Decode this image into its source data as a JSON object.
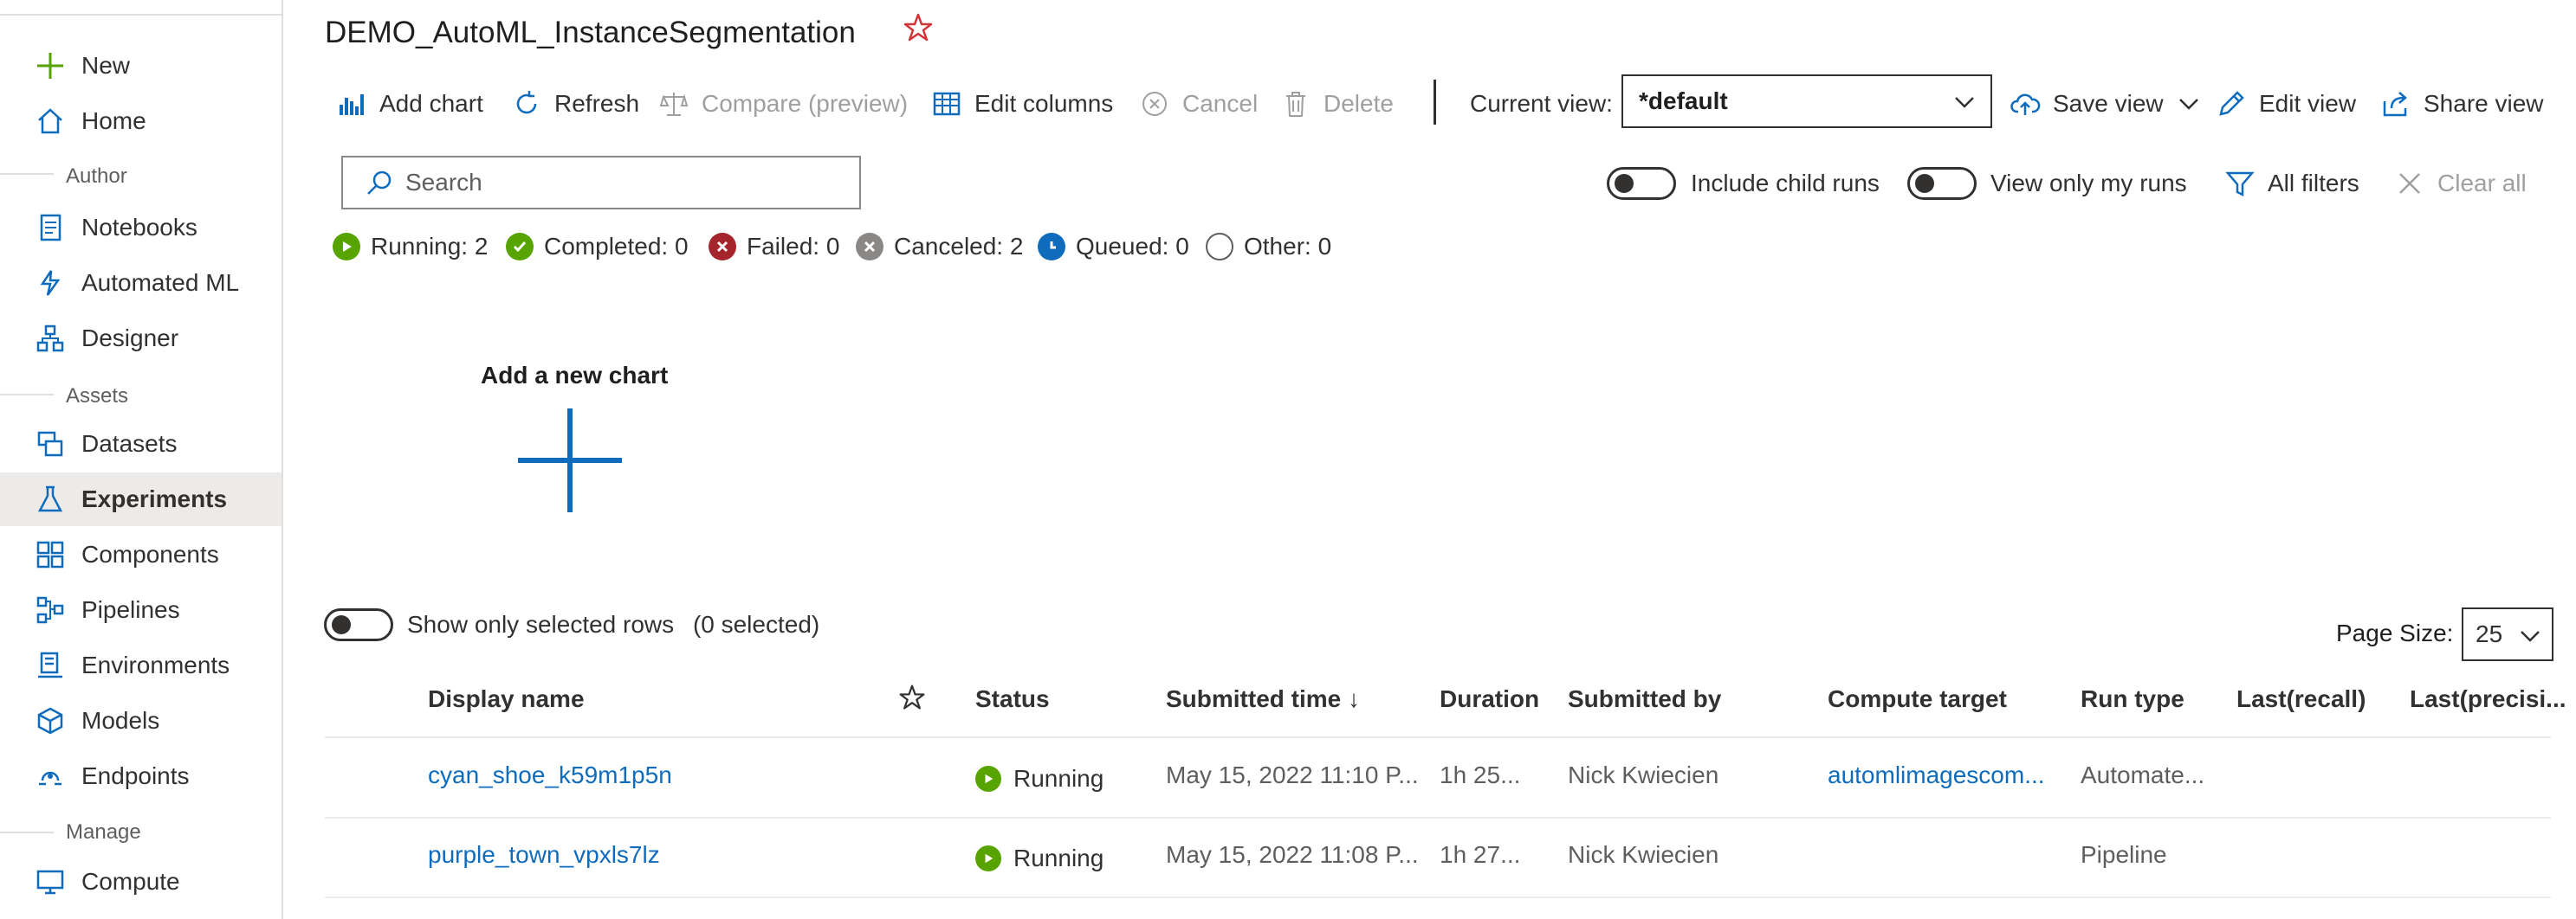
{
  "sidebar": {
    "new_label": "New",
    "home_label": "Home",
    "section_author": "Author",
    "notebooks_label": "Notebooks",
    "automl_label": "Automated ML",
    "designer_label": "Designer",
    "section_assets": "Assets",
    "datasets_label": "Datasets",
    "experiments_label": "Experiments",
    "components_label": "Components",
    "pipelines_label": "Pipelines",
    "environments_label": "Environments",
    "models_label": "Models",
    "endpoints_label": "Endpoints",
    "section_manage": "Manage",
    "compute_label": "Compute"
  },
  "page": {
    "title": "DEMO_AutoML_InstanceSegmentation"
  },
  "toolbar": {
    "add_chart": "Add chart",
    "refresh": "Refresh",
    "compare": "Compare (preview)",
    "edit_columns": "Edit columns",
    "cancel": "Cancel",
    "delete": "Delete",
    "current_view_label": "Current view:",
    "current_view_value": "*default",
    "save_view": "Save view",
    "edit_view": "Edit view",
    "share_view": "Share view"
  },
  "filters": {
    "search_placeholder": "Search",
    "include_child_runs": "Include child runs",
    "view_only_my_runs": "View only my runs",
    "all_filters": "All filters",
    "clear_all": "Clear all"
  },
  "status_counts": {
    "running": "Running: 2",
    "completed": "Completed: 0",
    "failed": "Failed: 0",
    "canceled": "Canceled: 2",
    "queued": "Queued: 0",
    "other": "Other: 0"
  },
  "chart_area": {
    "add_new_chart": "Add a new chart"
  },
  "table_controls": {
    "show_selected": "Show only selected rows",
    "selected_count": "(0 selected)",
    "page_size_label": "Page Size:",
    "page_size_value": "25"
  },
  "table": {
    "headers": {
      "display_name": "Display name",
      "status": "Status",
      "submitted_time": "Submitted time ↓",
      "duration": "Duration",
      "submitted_by": "Submitted by",
      "compute_target": "Compute target",
      "run_type": "Run type",
      "last_recall": "Last(recall)",
      "last_precision": "Last(precisi..."
    },
    "rows": [
      {
        "display_name": "cyan_shoe_k59m1p5n",
        "status": "Running",
        "submitted_time": "May 15, 2022 11:10 P...",
        "duration": "1h 25...",
        "submitted_by": "Nick Kwiecien",
        "compute_target": "automlimagescom...",
        "run_type": "Automate..."
      },
      {
        "display_name": "purple_town_vpxls7lz",
        "status": "Running",
        "submitted_time": "May 15, 2022 11:08 P...",
        "duration": "1h 27...",
        "submitted_by": "Nick Kwiecien",
        "compute_target": "",
        "run_type": "Pipeline"
      }
    ]
  },
  "colors": {
    "accent": "#0f6cbd",
    "running": "#57a300",
    "failed": "#a4262c",
    "canceled": "#8a8886",
    "queued": "#0f6cbd",
    "star": "#d13438"
  }
}
